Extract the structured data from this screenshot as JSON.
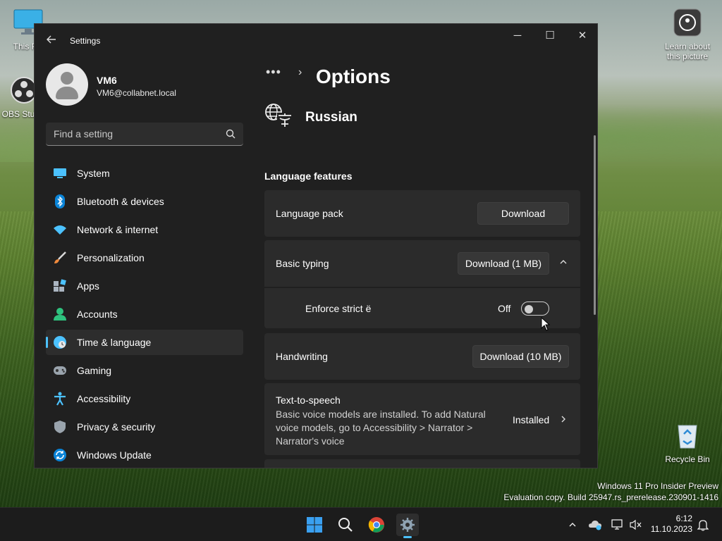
{
  "desktop": {
    "icons": {
      "this_pc": "This PC",
      "obs": "OBS Studio",
      "learn": "Learn about this picture",
      "recycle": "Recycle Bin"
    },
    "watermark_line1": "Windows 11 Pro Insider Preview",
    "watermark_line2": "Evaluation copy. Build 25947.rs_prerelease.230901-1416"
  },
  "window": {
    "title": "Settings",
    "controls": {
      "minimize": "─",
      "maximize": "☐",
      "close": "✕"
    }
  },
  "user": {
    "name": "VM6",
    "email": "VM6@collabnet.local"
  },
  "search": {
    "placeholder": "Find a setting"
  },
  "sidebar": {
    "items": [
      {
        "label": "System",
        "icon": "system-icon"
      },
      {
        "label": "Bluetooth & devices",
        "icon": "bluetooth-icon"
      },
      {
        "label": "Network & internet",
        "icon": "network-icon"
      },
      {
        "label": "Personalization",
        "icon": "brush-icon"
      },
      {
        "label": "Apps",
        "icon": "apps-icon"
      },
      {
        "label": "Accounts",
        "icon": "accounts-icon"
      },
      {
        "label": "Time & language",
        "icon": "time-language-icon",
        "active": true
      },
      {
        "label": "Gaming",
        "icon": "gaming-icon"
      },
      {
        "label": "Accessibility",
        "icon": "accessibility-icon"
      },
      {
        "label": "Privacy & security",
        "icon": "shield-icon"
      },
      {
        "label": "Windows Update",
        "icon": "update-icon"
      }
    ]
  },
  "content": {
    "breadcrumb_more": "•••",
    "breadcrumb_sep": "›",
    "page_title": "Options",
    "language": "Russian",
    "section_label": "Language features",
    "language_pack": {
      "label": "Language pack",
      "button": "Download"
    },
    "basic_typing": {
      "label": "Basic typing",
      "button": "Download (1 MB)",
      "chevron": "^"
    },
    "enforce": {
      "label": "Enforce strict ë",
      "state": "Off"
    },
    "handwriting": {
      "label": "Handwriting",
      "button": "Download (10 MB)"
    },
    "tts": {
      "label": "Text-to-speech",
      "desc": "Basic voice models are installed. To add Natural voice models, go to Accessibility > Narrator > Narrator's voice",
      "status": "Installed",
      "chevron": "›"
    }
  },
  "taskbar": {
    "clock_time": "6:12",
    "clock_date": "11.10.2023"
  },
  "colors": {
    "accent": "#4cc2ff",
    "window_bg": "#202020",
    "card_bg": "#2b2b2b"
  }
}
